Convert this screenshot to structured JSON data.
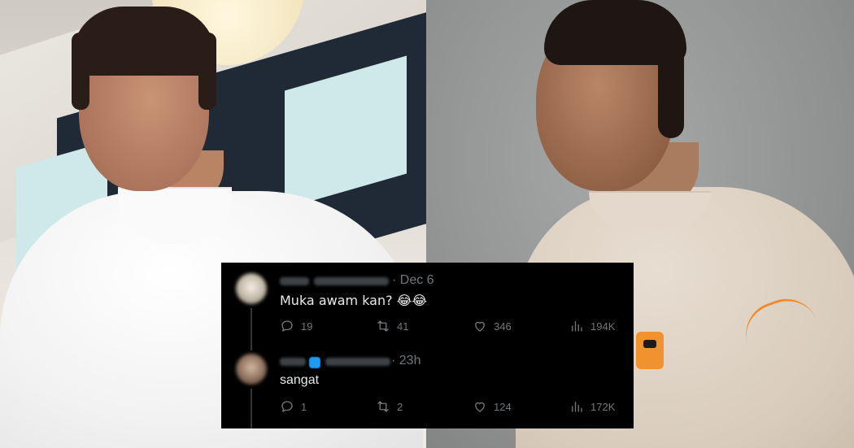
{
  "tweets": [
    {
      "time": "· Dec 6",
      "text": "Muka awam kan? 😂😂",
      "stats": {
        "replies": "19",
        "reposts": "41",
        "likes": "346",
        "views": "194K"
      }
    },
    {
      "time": "· 23h",
      "text": "sangat",
      "stats": {
        "replies": "1",
        "reposts": "2",
        "likes": "124",
        "views": "172K"
      }
    }
  ],
  "icons": {
    "reply": "reply-icon",
    "repost": "repost-icon",
    "like": "heart-icon",
    "views": "views-chart-icon"
  },
  "colors": {
    "tweet_background": "#000000",
    "tweet_text": "#e7e9ea",
    "muted_text": "#71767b",
    "verified_badge": "#1d9bf0",
    "logo_orange": "#f0922e"
  }
}
